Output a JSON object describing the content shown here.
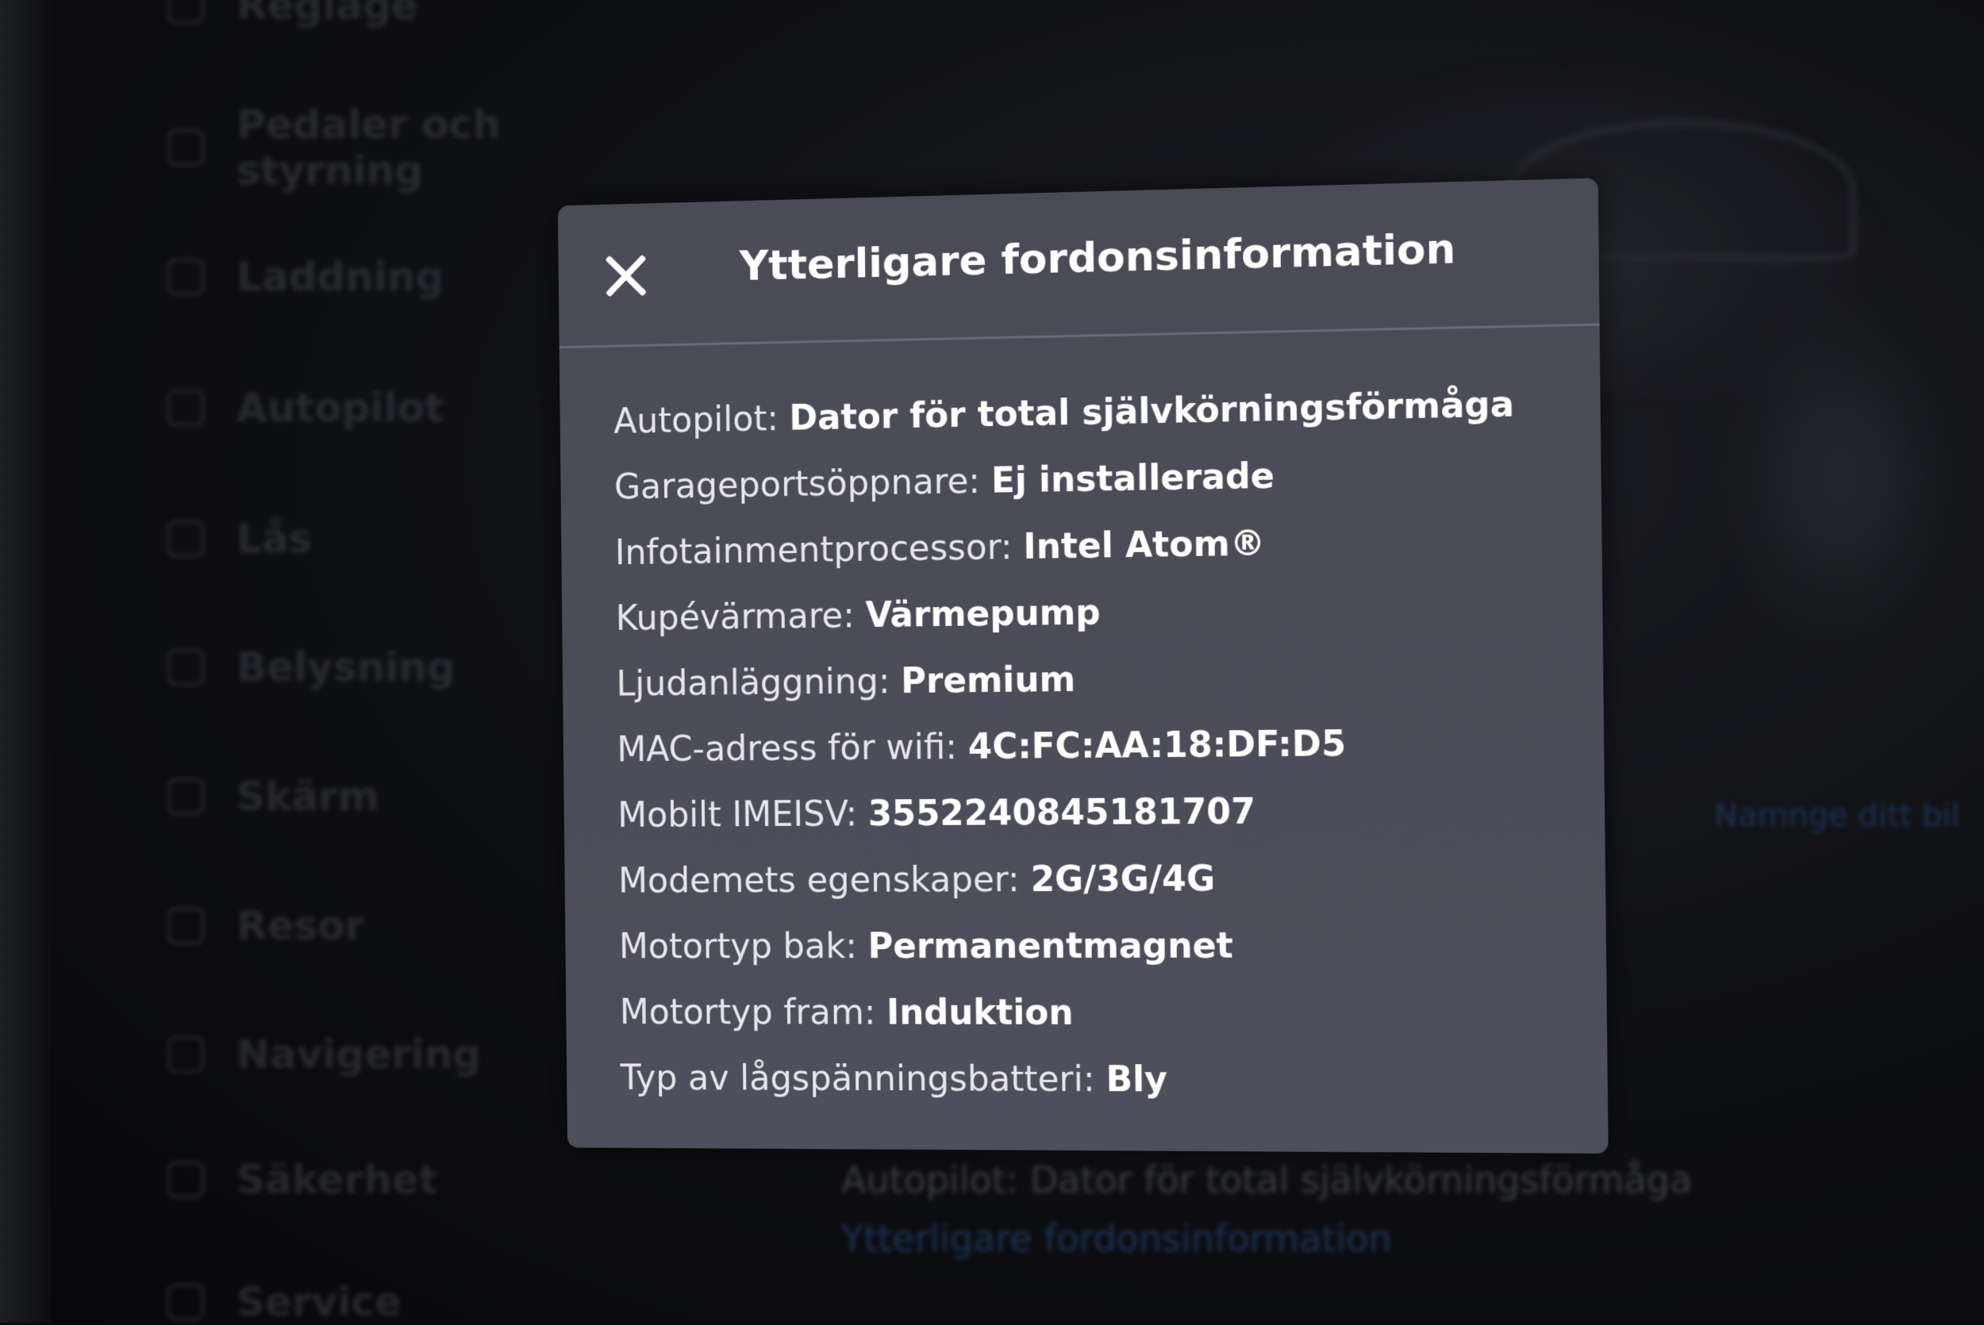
{
  "sidebar": {
    "items": [
      {
        "label": "Reglage",
        "icon": "toggle-icon"
      },
      {
        "label": "Pedaler och styrning",
        "icon": "car-icon"
      },
      {
        "label": "Laddning",
        "icon": "bolt-icon"
      },
      {
        "label": "Autopilot",
        "icon": "steering-wheel-icon"
      },
      {
        "label": "Lås",
        "icon": "lock-icon"
      },
      {
        "label": "Belysning",
        "icon": "light-icon"
      },
      {
        "label": "Skärm",
        "icon": "display-icon"
      },
      {
        "label": "Resor",
        "icon": "trips-icon"
      },
      {
        "label": "Navigering",
        "icon": "navigation-icon"
      },
      {
        "label": "Säkerhet",
        "icon": "safety-icon"
      },
      {
        "label": "Service",
        "icon": "wrench-icon"
      }
    ]
  },
  "background": {
    "side_link": "Namnge ditt bil",
    "autopilot_line": "Autopilot: Dator för total självkörningsförmåga",
    "more_info_link": "Ytterligare fordonsinformation"
  },
  "modal": {
    "title": "Ytterligare fordonsinformation",
    "close_icon": "close-icon",
    "rows": [
      {
        "label": "Autopilot:",
        "value": "Dator för total självkörningsförmåga"
      },
      {
        "label": "Garageportsöppnare:",
        "value": "Ej installerade"
      },
      {
        "label": "Infotainmentprocessor:",
        "value": "Intel Atom®"
      },
      {
        "label": "Kupévärmare:",
        "value": "Värmepump"
      },
      {
        "label": "Ljudanläggning:",
        "value": "Premium"
      },
      {
        "label": "MAC-adress för wifi:",
        "value": "4C:FC:AA:18:DF:D5"
      },
      {
        "label": "Mobilt IMEISV:",
        "value": "3552240845181707"
      },
      {
        "label": "Modemets egenskaper:",
        "value": "2G/3G/4G"
      },
      {
        "label": "Motortyp bak:",
        "value": "Permanentmagnet"
      },
      {
        "label": "Motortyp fram:",
        "value": "Induktion"
      },
      {
        "label": "Typ av lågspänningsbatteri:",
        "value": "Bly"
      }
    ]
  },
  "colors": {
    "modal_bg": "#4b4c58",
    "text": "#ffffff",
    "screen_bg": "#0b0b0d",
    "link_blue": "#1c3355"
  }
}
